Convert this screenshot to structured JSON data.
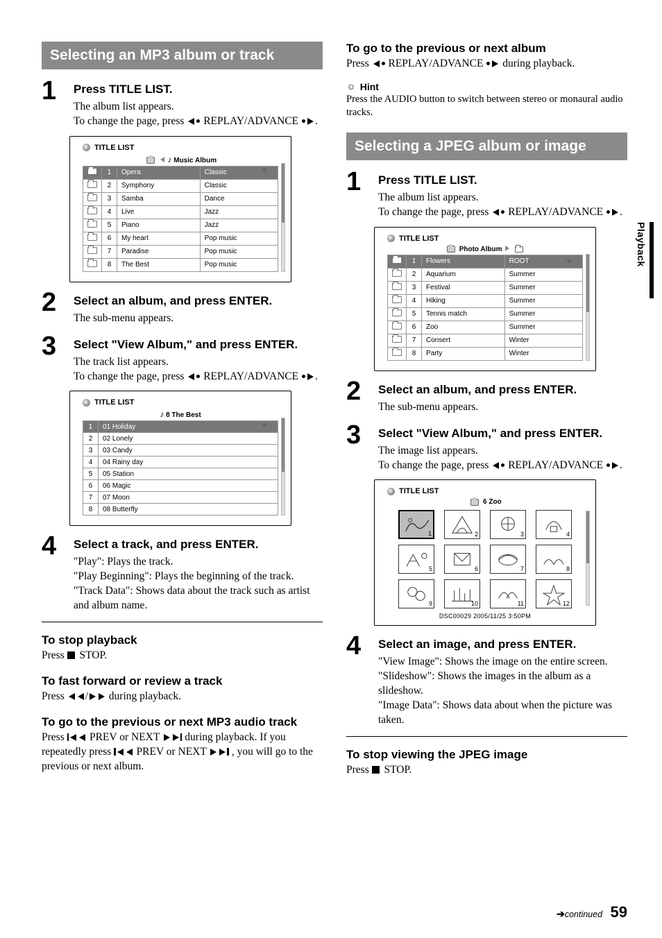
{
  "sidebar_label": "Playback",
  "left": {
    "section_title": "Selecting an MP3 album or track",
    "step1": {
      "head": "Press TITLE LIST.",
      "p1": "The album list appears.",
      "p2_a": "To change the page, press ",
      "p2_b": " REPLAY/ADVANCE ",
      "p2_c": "."
    },
    "win1": {
      "title": "TITLE LIST",
      "crumb": "Music Album",
      "rows": [
        {
          "n": "1",
          "name": "Opera",
          "cat": "Classic",
          "sel": true
        },
        {
          "n": "2",
          "name": "Symphony",
          "cat": "Classic"
        },
        {
          "n": "3",
          "name": "Samba",
          "cat": "Dance"
        },
        {
          "n": "4",
          "name": "Live",
          "cat": "Jazz"
        },
        {
          "n": "5",
          "name": "Piano",
          "cat": "Jazz"
        },
        {
          "n": "6",
          "name": "My heart",
          "cat": "Pop music"
        },
        {
          "n": "7",
          "name": "Paradise",
          "cat": "Pop music"
        },
        {
          "n": "8",
          "name": "The Best",
          "cat": "Pop music"
        }
      ]
    },
    "step2": {
      "head": "Select an album, and press ENTER.",
      "p": "The sub-menu appears."
    },
    "step3": {
      "head": "Select \"View Album,\" and press ENTER.",
      "p1": "The track list appears.",
      "p2_a": "To change the page, press ",
      "p2_b": " REPLAY/ADVANCE ",
      "p2_c": "."
    },
    "win2": {
      "title": "TITLE LIST",
      "crumb": "8  The Best",
      "rows": [
        {
          "n": "1",
          "name": "01 Holiday",
          "sel": true
        },
        {
          "n": "2",
          "name": "02 Lonely"
        },
        {
          "n": "3",
          "name": "03 Candy"
        },
        {
          "n": "4",
          "name": "04 Rainy day"
        },
        {
          "n": "5",
          "name": "05 Station"
        },
        {
          "n": "6",
          "name": "06 Magic"
        },
        {
          "n": "7",
          "name": "07 Moon"
        },
        {
          "n": "8",
          "name": "08 Butterfly"
        }
      ]
    },
    "step4": {
      "head": "Select a track, and press ENTER.",
      "p1": "\"Play\": Plays the track.",
      "p2": "\"Play Beginning\": Plays the beginning of the track.",
      "p3": "\"Track Data\": Shows data about the track such as artist and album name."
    },
    "stop": {
      "head": "To stop playback",
      "p_a": "Press ",
      "p_b": " STOP."
    },
    "ff": {
      "head": "To fast forward or review a track",
      "p_a": "Press ",
      "p_b": " during playback."
    },
    "skip": {
      "head": "To go to the previous or next MP3 audio track",
      "p_a": "Press ",
      "p_b": " PREV or NEXT ",
      "p_c": " during playback. If you repeatedly press ",
      "p_d": " PREV or NEXT ",
      "p_e": ", you will go to the previous or next album."
    }
  },
  "right": {
    "album_nav": {
      "head": "To go to the previous or next album",
      "p_a": "Press ",
      "p_b": " REPLAY/ADVANCE ",
      "p_c": " during playback."
    },
    "hint": {
      "label": "Hint",
      "p": "Press the AUDIO button to switch between stereo or monaural audio tracks."
    },
    "section_title": "Selecting a JPEG album or image",
    "step1": {
      "head": "Press TITLE LIST.",
      "p1": "The album list appears.",
      "p2_a": "To change the page, press ",
      "p2_b": " REPLAY/ADVANCE ",
      "p2_c": "."
    },
    "win1": {
      "title": "TITLE LIST",
      "crumb": "Photo Album",
      "rows": [
        {
          "n": "1",
          "name": "Flowers",
          "cat": "ROOT",
          "sel": true
        },
        {
          "n": "2",
          "name": "Aquarium",
          "cat": "Summer"
        },
        {
          "n": "3",
          "name": "Festival",
          "cat": "Summer"
        },
        {
          "n": "4",
          "name": "Hiking",
          "cat": "Summer"
        },
        {
          "n": "5",
          "name": "Tennis match",
          "cat": "Summer"
        },
        {
          "n": "6",
          "name": "Zoo",
          "cat": "Summer"
        },
        {
          "n": "7",
          "name": "Consert",
          "cat": "Winter"
        },
        {
          "n": "8",
          "name": "Party",
          "cat": "Winter"
        }
      ]
    },
    "step2": {
      "head": "Select an album, and press ENTER.",
      "p": "The sub-menu appears."
    },
    "step3": {
      "head": "Select \"View Album,\" and press ENTER.",
      "p1": "The image list appears.",
      "p2_a": "To change the page, press ",
      "p2_b": " REPLAY/ADVANCE ",
      "p2_c": "."
    },
    "win2": {
      "title": "TITLE LIST",
      "crumb": "6  Zoo",
      "status": "DSC00029    2005/11/25   3:50PM",
      "nums": [
        "1",
        "2",
        "3",
        "4",
        "5",
        "6",
        "7",
        "8",
        "9",
        "10",
        "11",
        "12"
      ]
    },
    "step4": {
      "head": "Select an image, and press ENTER.",
      "p1": "\"View Image\": Shows the image on the entire screen.",
      "p2": "\"Slideshow\": Shows the images in the album as a slideshow.",
      "p3": "\"Image Data\": Shows data about when the picture was taken."
    },
    "stop": {
      "head": "To stop viewing the JPEG image",
      "p_a": "Press ",
      "p_b": " STOP."
    }
  },
  "footer": {
    "continued": "continued",
    "page": "59"
  }
}
